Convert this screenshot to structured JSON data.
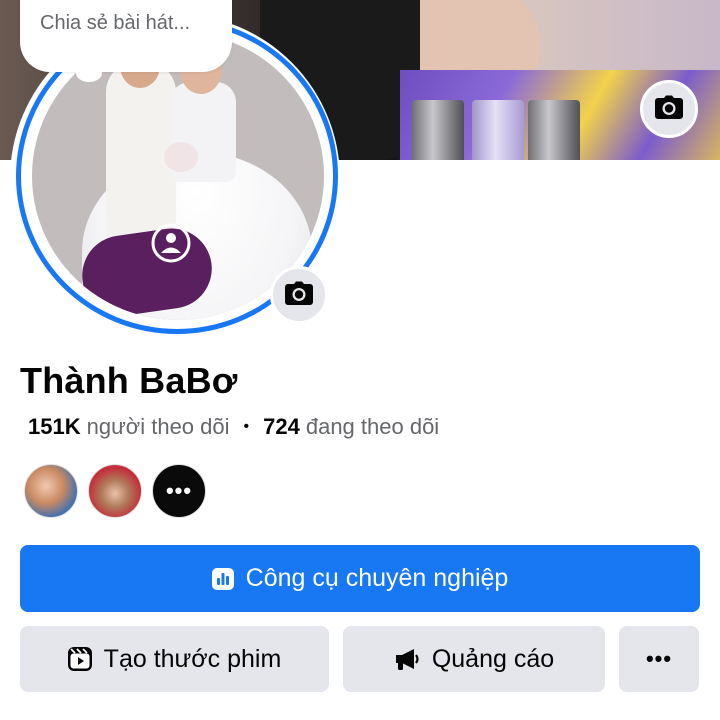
{
  "status_prompt": {
    "placeholder": "Chia sẻ bài hát..."
  },
  "profile": {
    "name": "Thành BaBơ",
    "followers_count": "151K",
    "followers_label": "người theo dõi",
    "separator": "•",
    "following_count": "724",
    "following_label": "đang theo dõi"
  },
  "friends": {
    "more_label": "•••"
  },
  "buttons": {
    "professional_tools": "Công cụ chuyên nghiệp",
    "create_reel": "Tạo thước phim",
    "ads": "Quảng cáo",
    "more": "•••"
  },
  "colors": {
    "accent": "#1877f2",
    "secondary_button": "#e4e6eb",
    "text_primary": "#050505",
    "text_secondary": "#65676b"
  },
  "icons": {
    "cover_camera": "camera-icon",
    "avatar_camera": "camera-icon",
    "professional_tools": "dashboard-icon",
    "create_reel": "reel-icon",
    "ads": "megaphone-icon"
  }
}
